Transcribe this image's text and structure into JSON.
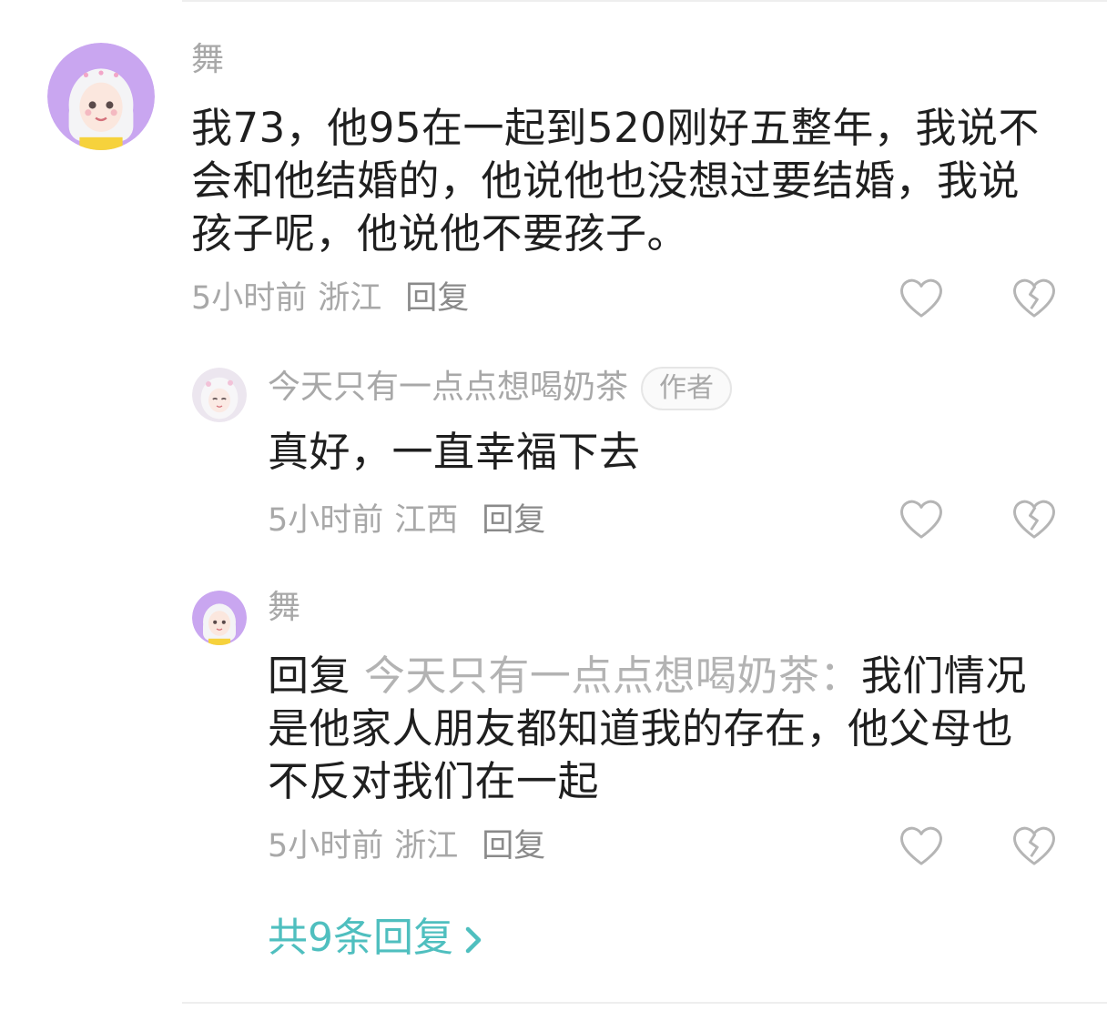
{
  "comment": {
    "username": "舞",
    "text": "我73，他95在一起到520刚好五整年，我说不会和他结婚的，他说他也没想过要结婚，我说孩子呢，他说他不要孩子。",
    "time": "5小时前",
    "location": "浙江",
    "reply_label": "回复",
    "like_icon": "heart-outline-icon",
    "dislike_icon": "broken-heart-icon"
  },
  "replies": [
    {
      "username": "今天只有一点点想喝奶茶",
      "badge": "作者",
      "text": "真好，一直幸福下去",
      "time": "5小时前",
      "location": "江西",
      "reply_label": "回复"
    },
    {
      "username": "舞",
      "reply_prefix": "回复",
      "reply_to": "今天只有一点点想喝奶茶：",
      "text": "我们情况是他家人朋友都知道我的存在，他父母也不反对我们在一起",
      "time": "5小时前",
      "location": "浙江",
      "reply_label": "回复"
    }
  ],
  "more_replies": "共9条回复",
  "colors": {
    "accent": "#4fbfbf",
    "avatar_bg": "#c9a6f0",
    "meta_gray": "#a8a8a8",
    "text": "#1f1f1f"
  }
}
